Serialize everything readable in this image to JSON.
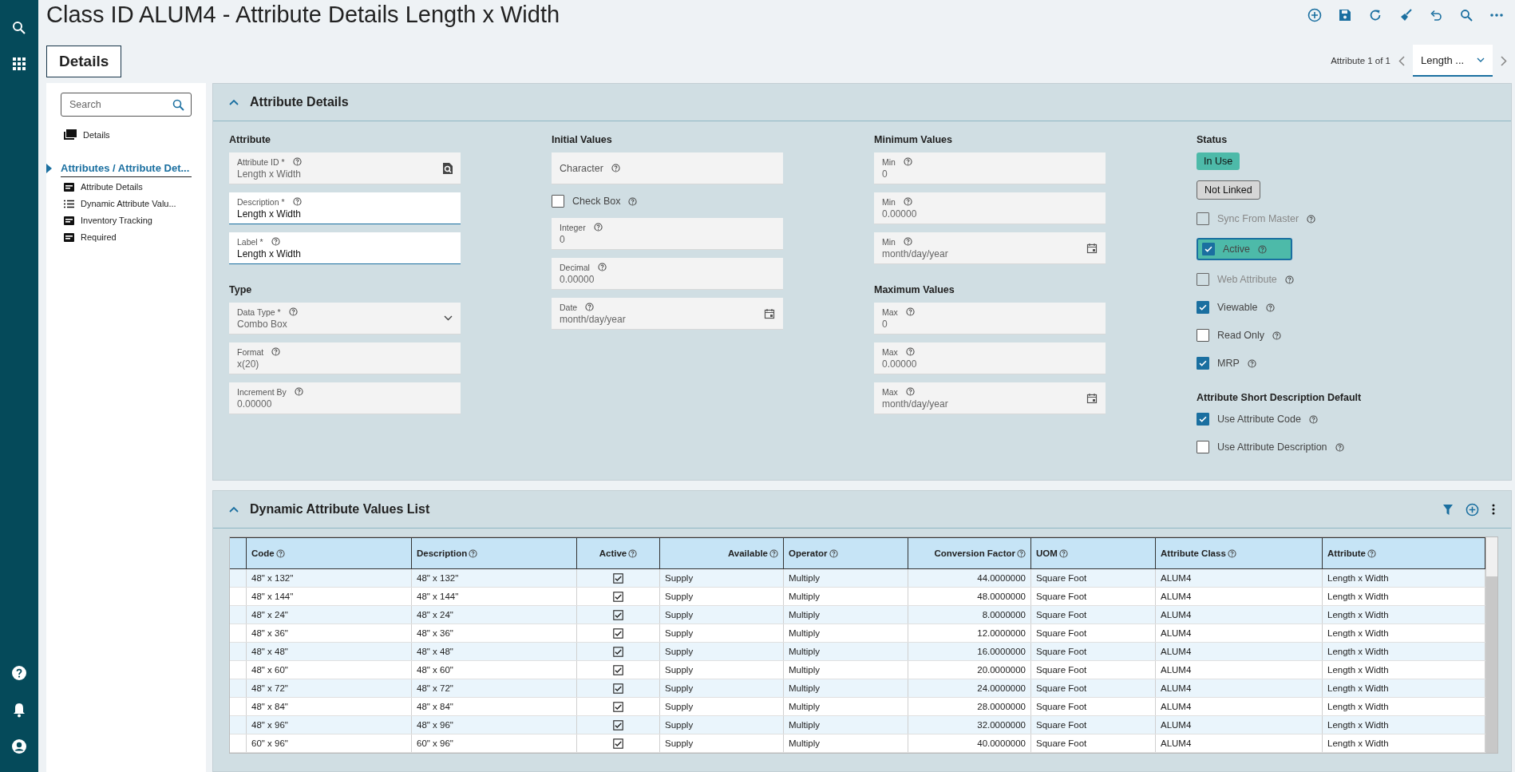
{
  "page_title": "Class ID ALUM4 - Attribute Details Length x Width",
  "tabs": [
    {
      "label": "Details",
      "selected": true
    }
  ],
  "record_nav": {
    "counter": "Attribute 1 of 1",
    "dropdown_value": "Length ..."
  },
  "sidebar": {
    "search_placeholder": "Search",
    "items": [
      {
        "label": "Details",
        "kind": "stack",
        "selected": false
      },
      {
        "label": "Attributes / Attribute Det...",
        "kind": "group",
        "selected": true,
        "children": [
          {
            "label": "Attribute Details",
            "kind": "form"
          },
          {
            "label": "Dynamic Attribute Valu...",
            "kind": "list"
          },
          {
            "label": "Inventory Tracking",
            "kind": "form"
          },
          {
            "label": "Required",
            "kind": "form"
          }
        ]
      }
    ]
  },
  "attribute_details": {
    "title": "Attribute Details",
    "expanded": true,
    "columns": [
      {
        "sections": [
          {
            "heading": "Attribute",
            "fields": [
              {
                "kind": "lookup",
                "label": "Attribute ID *",
                "value": "Length x Width",
                "editable": false
              },
              {
                "kind": "text",
                "label": "Description *",
                "value": "Length x Width",
                "editable": true
              },
              {
                "kind": "text",
                "label": "Label *",
                "value": "Length x Width",
                "editable": true
              }
            ]
          },
          {
            "heading": "Type",
            "fields": [
              {
                "kind": "select",
                "label": "Data Type *",
                "value": "Combo Box",
                "editable": false
              },
              {
                "kind": "text",
                "label": "Format",
                "value": "x(20)",
                "editable": false
              },
              {
                "kind": "text",
                "label": "Increment By",
                "value": "0.00000",
                "editable": false
              }
            ]
          }
        ]
      },
      {
        "sections": [
          {
            "heading": "Initial Values",
            "fields": [
              {
                "kind": "text",
                "label": "Character",
                "editable": false
              },
              {
                "kind": "checkbox",
                "label": "Check Box",
                "checked": false,
                "disabled": false,
                "focused": false
              },
              {
                "kind": "text",
                "label": "Integer",
                "value": "0",
                "editable": false
              },
              {
                "kind": "text",
                "label": "Decimal",
                "value": "0.00000",
                "editable": false
              },
              {
                "kind": "date",
                "label": "Date",
                "value": "month/day/year",
                "editable": false
              }
            ]
          }
        ]
      },
      {
        "sections": [
          {
            "heading": "Minimum Values",
            "fields": [
              {
                "kind": "text",
                "label": "Min",
                "value": "0",
                "editable": false
              },
              {
                "kind": "text",
                "label": "Min",
                "value": "0.00000",
                "editable": false
              },
              {
                "kind": "date",
                "label": "Min",
                "value": "month/day/year",
                "editable": false
              }
            ]
          },
          {
            "heading": "Maximum Values",
            "fields": [
              {
                "kind": "text",
                "label": "Max",
                "value": "0",
                "editable": false
              },
              {
                "kind": "text",
                "label": "Max",
                "value": "0.00000",
                "editable": false
              },
              {
                "kind": "date",
                "label": "Max",
                "value": "month/day/year",
                "editable": false
              }
            ]
          }
        ]
      },
      {
        "sections": [
          {
            "heading": "Status",
            "fields": [
              {
                "kind": "badge",
                "label": "In Use",
                "color": "#4dbaa9"
              },
              {
                "kind": "badge",
                "label": "Not Linked",
                "color": "#d6d6d6"
              },
              {
                "kind": "checkbox",
                "label": "Sync From Master",
                "checked": false,
                "disabled": true,
                "focused": false
              },
              {
                "kind": "checkbox",
                "label": "Active",
                "checked": true,
                "disabled": false,
                "focused": true
              },
              {
                "kind": "checkbox",
                "label": "Web Attribute",
                "checked": false,
                "disabled": true,
                "focused": false
              },
              {
                "kind": "checkbox",
                "label": "Viewable",
                "checked": true,
                "disabled": false,
                "focused": false
              },
              {
                "kind": "checkbox",
                "label": "Read Only",
                "checked": false,
                "disabled": false,
                "focused": false
              },
              {
                "kind": "checkbox",
                "label": "MRP",
                "checked": true,
                "disabled": false,
                "focused": false
              }
            ]
          },
          {
            "heading": "Attribute Short Description Default",
            "fields": [
              {
                "kind": "checkbox",
                "label": "Use Attribute Code",
                "checked": true,
                "disabled": false,
                "focused": false
              },
              {
                "kind": "checkbox",
                "label": "Use Attribute Description",
                "checked": false,
                "disabled": false,
                "focused": false
              }
            ]
          }
        ]
      }
    ]
  },
  "values_list": {
    "title": "Dynamic Attribute Values List",
    "expanded": true,
    "columns": [
      {
        "label": "Code"
      },
      {
        "label": "Description"
      },
      {
        "label": "Active"
      },
      {
        "label": "Available"
      },
      {
        "label": "Operator"
      },
      {
        "label": "Conversion Factor"
      },
      {
        "label": "UOM"
      },
      {
        "label": "Attribute Class"
      },
      {
        "label": "Attribute"
      }
    ],
    "rows": [
      {
        "code": "48\" x 132\"",
        "description": "48\" x 132\"",
        "active": true,
        "available": "Supply",
        "operator": "Multiply",
        "conversion_factor": "44.0000000",
        "uom": "Square Foot",
        "attribute_class": "ALUM4",
        "attribute": "Length x Width"
      },
      {
        "code": "48\" x 144\"",
        "description": "48\" x 144\"",
        "active": true,
        "available": "Supply",
        "operator": "Multiply",
        "conversion_factor": "48.0000000",
        "uom": "Square Foot",
        "attribute_class": "ALUM4",
        "attribute": "Length x Width"
      },
      {
        "code": "48\" x 24\"",
        "description": "48\" x 24\"",
        "active": true,
        "available": "Supply",
        "operator": "Multiply",
        "conversion_factor": "8.0000000",
        "uom": "Square Foot",
        "attribute_class": "ALUM4",
        "attribute": "Length x Width"
      },
      {
        "code": "48\" x 36\"",
        "description": "48\" x 36\"",
        "active": true,
        "available": "Supply",
        "operator": "Multiply",
        "conversion_factor": "12.0000000",
        "uom": "Square Foot",
        "attribute_class": "ALUM4",
        "attribute": "Length x Width"
      },
      {
        "code": "48\" x 48\"",
        "description": "48\" x 48\"",
        "active": true,
        "available": "Supply",
        "operator": "Multiply",
        "conversion_factor": "16.0000000",
        "uom": "Square Foot",
        "attribute_class": "ALUM4",
        "attribute": "Length x Width"
      },
      {
        "code": "48\" x 60\"",
        "description": "48\" x 60\"",
        "active": true,
        "available": "Supply",
        "operator": "Multiply",
        "conversion_factor": "20.0000000",
        "uom": "Square Foot",
        "attribute_class": "ALUM4",
        "attribute": "Length x Width"
      },
      {
        "code": "48\" x 72\"",
        "description": "48\" x 72\"",
        "active": true,
        "available": "Supply",
        "operator": "Multiply",
        "conversion_factor": "24.0000000",
        "uom": "Square Foot",
        "attribute_class": "ALUM4",
        "attribute": "Length x Width"
      },
      {
        "code": "48\" x 84\"",
        "description": "48\" x 84\"",
        "active": true,
        "available": "Supply",
        "operator": "Multiply",
        "conversion_factor": "28.0000000",
        "uom": "Square Foot",
        "attribute_class": "ALUM4",
        "attribute": "Length x Width"
      },
      {
        "code": "48\" x 96\"",
        "description": "48\" x 96\"",
        "active": true,
        "available": "Supply",
        "operator": "Multiply",
        "conversion_factor": "32.0000000",
        "uom": "Square Foot",
        "attribute_class": "ALUM4",
        "attribute": "Length x Width"
      },
      {
        "code": "60\" x 96\"",
        "description": "60\" x 96\"",
        "active": true,
        "available": "Supply",
        "operator": "Multiply",
        "conversion_factor": "40.0000000",
        "uom": "Square Foot",
        "attribute_class": "ALUM4",
        "attribute": "Length x Width"
      }
    ]
  }
}
